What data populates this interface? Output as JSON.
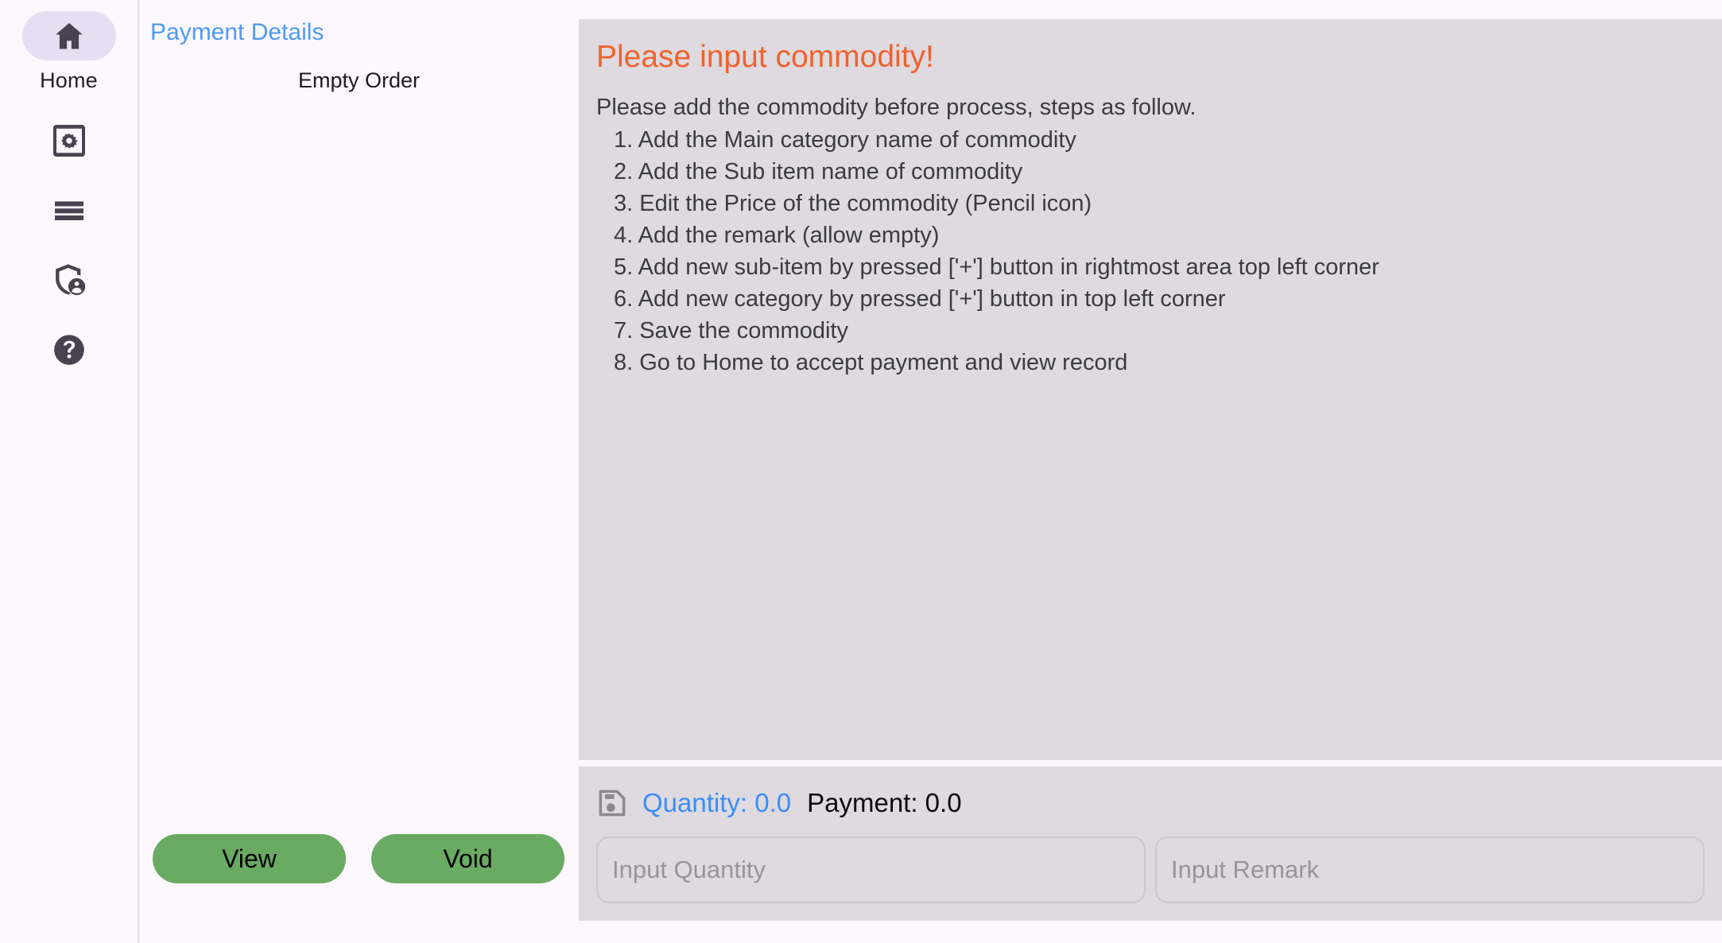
{
  "sidebar": {
    "items": [
      {
        "label": "Home",
        "icon": "home-icon",
        "active": true
      },
      {
        "label": "",
        "icon": "settings-gear-icon",
        "active": false
      },
      {
        "label": "",
        "icon": "menu-bars-icon",
        "active": false
      },
      {
        "label": "",
        "icon": "shield-person-icon",
        "active": false
      },
      {
        "label": "",
        "icon": "help-question-icon",
        "active": false
      }
    ],
    "active_pill_color": "#e5dff4"
  },
  "order_panel": {
    "title": "Payment Details",
    "title_color": "#4d9bf5",
    "empty_text": "Empty Order",
    "buttons": [
      {
        "label": "View",
        "color": "#69ab62"
      },
      {
        "label": "Void",
        "color": "#69ab62"
      }
    ]
  },
  "main_panel": {
    "alert_title": "Please input commodity!",
    "alert_color": "#f1622c",
    "lead": "Please add the commodity before process, steps as follow.",
    "steps": [
      "1. Add the Main category name of commodity",
      "2. Add the Sub item name of commodity",
      "3. Edit the Price of the commodity (Pencil icon)",
      "4. Add the remark (allow empty)",
      "5. Add new sub-item by pressed ['+'] button in rightmost area top left corner",
      "6. Add new category by pressed ['+'] button in top left corner",
      "7. Save the commodity",
      "8. Go to Home to accept payment and view record"
    ],
    "panel_bg": "#dedae0"
  },
  "totals": {
    "save_icon": "save-floppy-icon",
    "quantity_label": "Quantity: 0.0",
    "quantity_color": "#3a8dfb",
    "payment_label": "Payment: 0.0",
    "payment_color": "#0a0a0c",
    "quantity_input_placeholder": "Input Quantity",
    "quantity_input_value": "",
    "remark_input_placeholder": "Input Remark",
    "remark_input_value": ""
  }
}
